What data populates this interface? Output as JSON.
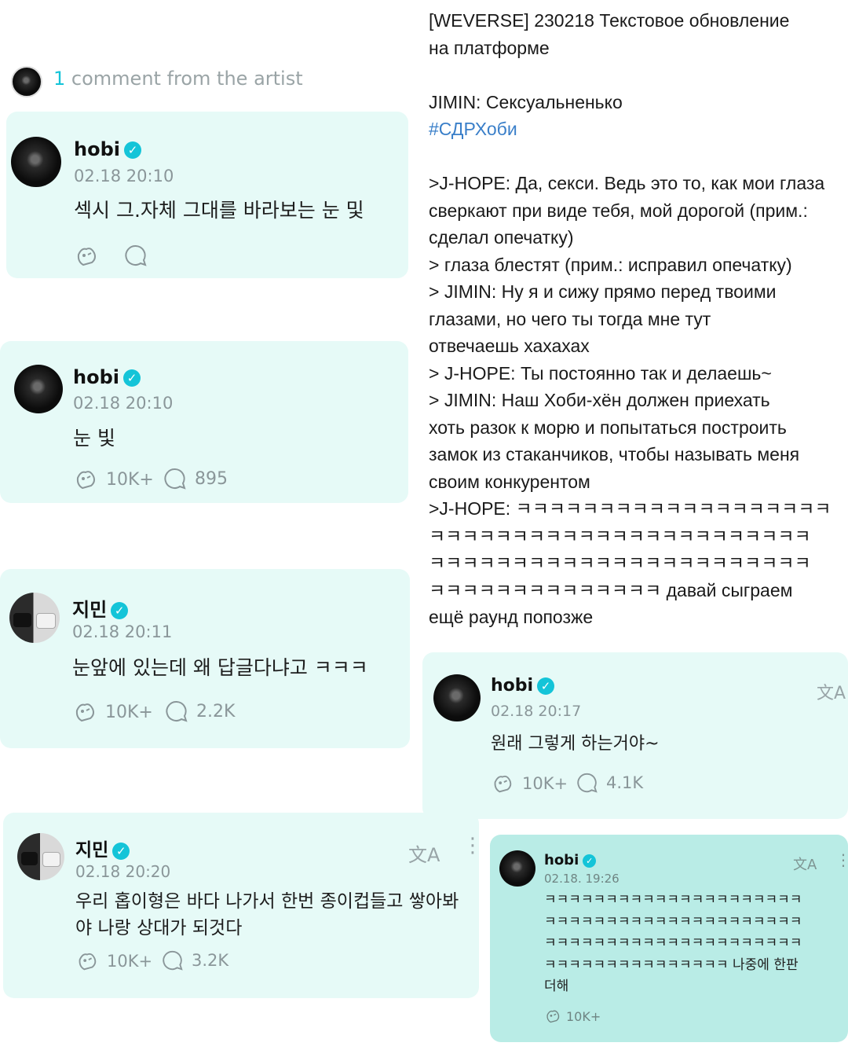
{
  "header": {
    "count": "1",
    "label": "comment from the artist"
  },
  "comments": [
    {
      "user": "hobi",
      "time": "02.18 20:10",
      "text": "섹시 그.자체 그대를 바라보는 눈 및",
      "likes": "",
      "replies": ""
    },
    {
      "user": "hobi",
      "time": "02.18 20:10",
      "text": "눈 빛",
      "likes": "10K+",
      "replies": "895"
    },
    {
      "user": "지민",
      "time": "02.18 20:11",
      "text": "눈앞에 있는데 왜 답글다냐고 ㅋㅋㅋ",
      "likes": "10K+",
      "replies": "2.2K"
    },
    {
      "user": "hobi",
      "time": "02.18 20:17",
      "text": "원래 그렇게 하는거야~",
      "likes": "10K+",
      "replies": "4.1K"
    },
    {
      "user": "지민",
      "time": "02.18 20:20",
      "text_lines": [
        "우리 홉이형은 바다 나가서 한번 종이컵들고 쌓아봐",
        "야 나랑 상대가 되것다"
      ],
      "likes": "10K+",
      "replies": "3.2K"
    },
    {
      "user": "hobi",
      "time": "02.18. 19:26",
      "text_lines": [
        "ㅋㅋㅋㅋㅋㅋㅋㅋㅋㅋㅋㅋㅋㅋㅋㅋㅋㅋㅋㅋㅋ",
        "ㅋㅋㅋㅋㅋㅋㅋㅋㅋㅋㅋㅋㅋㅋㅋㅋㅋㅋㅋㅋㅋ",
        "ㅋㅋㅋㅋㅋㅋㅋㅋㅋㅋㅋㅋㅋㅋㅋㅋㅋㅋㅋㅋㅋ",
        "ㅋㅋㅋㅋㅋㅋㅋㅋㅋㅋㅋㅋㅋㅋㅋ 나중에 한판",
        "더해"
      ],
      "likes": "10K+"
    }
  ],
  "translation": {
    "lines": [
      "[WEVERSE] 230218 Текстовое обновление",
      "на платформе",
      "",
      "JIMIN: Сексуальненько",
      "#СДРХоби",
      "",
      ">J-HOPE: Да, секси. Ведь это то, как мои глаза",
      "сверкают при виде тебя, мой дорогой (прим.:",
      "сделал опечатку)",
      "> глаза блестят (прим.: исправил опечатку)",
      "> JIMIN: Ну я и сижу прямо перед твоими",
      "глазами, но чего ты тогда мне тут",
      "отвечаешь хахахах",
      "> J-HOPE: Ты постоянно так и делаешь~",
      "> JIMIN: Наш Хоби-хён должен приехать",
      "хоть разок к морю и попытаться построить",
      "замок из стаканчиков, чтобы называть меня",
      "своим конкурентом",
      ">J-HOPE: ㅋㅋㅋㅋㅋㅋㅋㅋㅋㅋㅋㅋㅋㅋㅋㅋㅋㅋㅋ",
      "ㅋㅋㅋㅋㅋㅋㅋㅋㅋㅋㅋㅋㅋㅋㅋㅋㅋㅋㅋㅋㅋㅋㅋ",
      "ㅋㅋㅋㅋㅋㅋㅋㅋㅋㅋㅋㅋㅋㅋㅋㅋㅋㅋㅋㅋㅋㅋㅋ",
      "ㅋㅋㅋㅋㅋㅋㅋㅋㅋㅋㅋㅋㅋㅋ давай сыграем",
      "ещё раунд попозже"
    ]
  },
  "colors": {
    "card_bg": "#e6faf7",
    "card_dark_bg": "#b9ece6",
    "accent": "#14c4d8",
    "hashtag": "#3a7fc9",
    "muted": "#8a9699"
  },
  "icons": {
    "translate": "文A",
    "verified": "✓"
  }
}
